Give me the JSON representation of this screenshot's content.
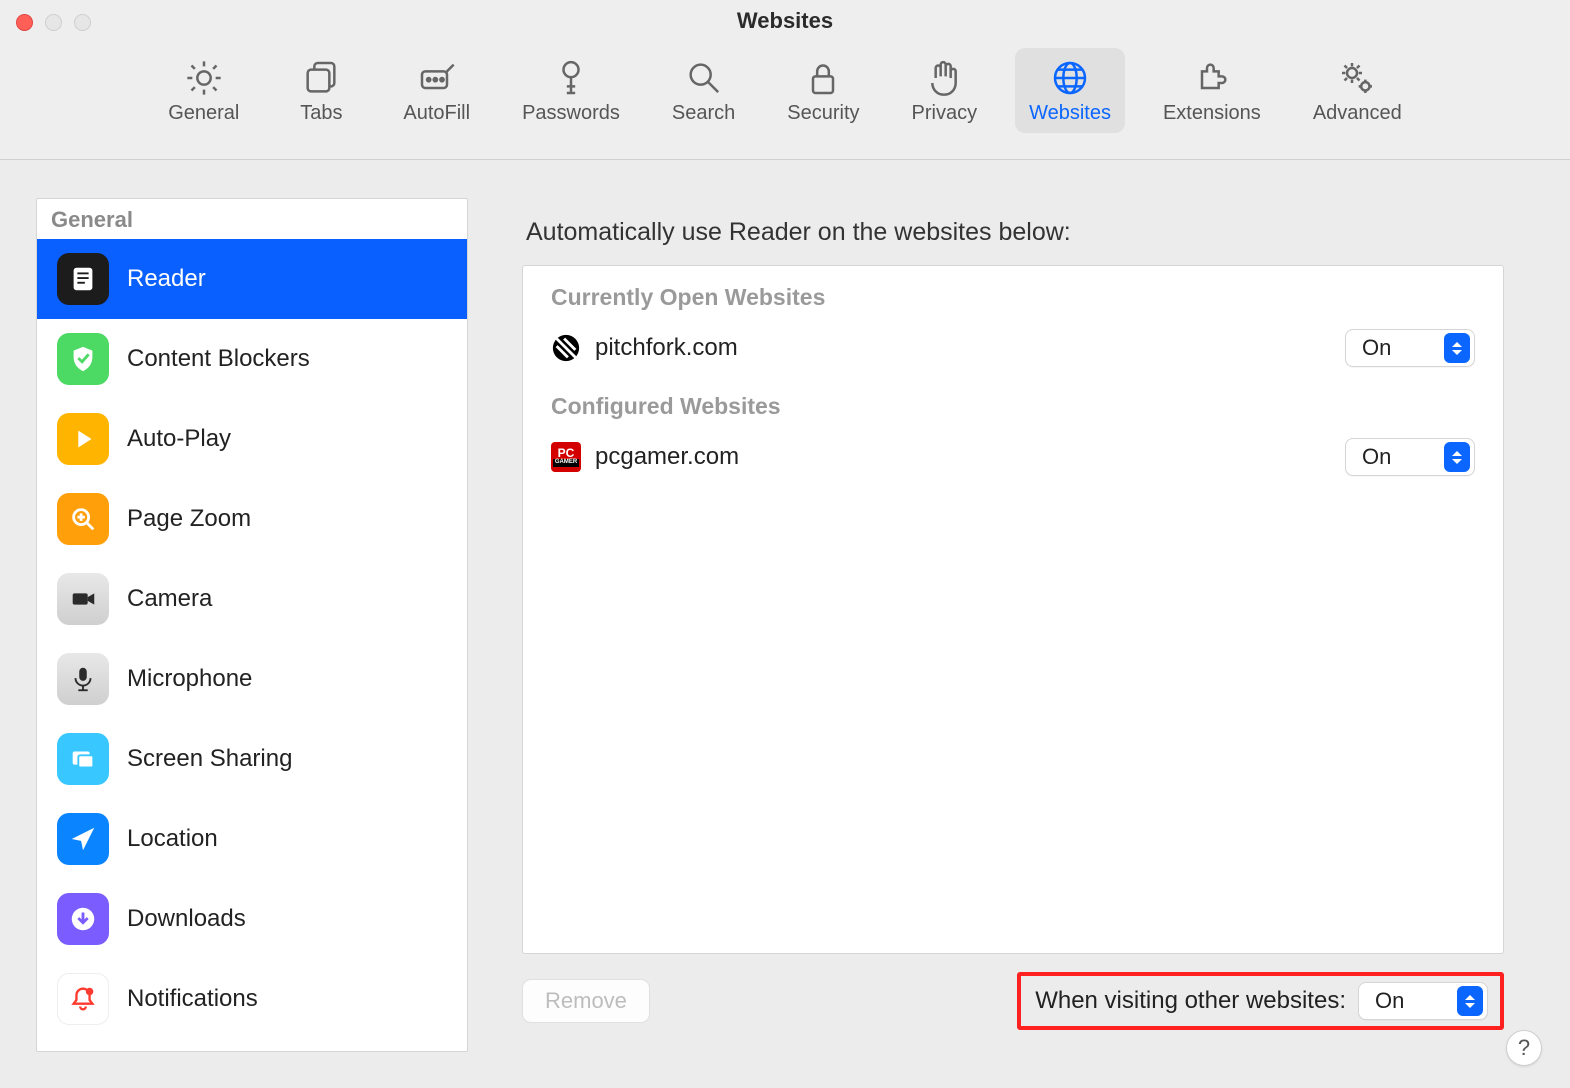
{
  "window": {
    "title": "Websites"
  },
  "toolbar": {
    "items": [
      {
        "label": "General",
        "icon": "gear"
      },
      {
        "label": "Tabs",
        "icon": "tabs"
      },
      {
        "label": "AutoFill",
        "icon": "autofill"
      },
      {
        "label": "Passwords",
        "icon": "key"
      },
      {
        "label": "Search",
        "icon": "search"
      },
      {
        "label": "Security",
        "icon": "lock"
      },
      {
        "label": "Privacy",
        "icon": "hand"
      },
      {
        "label": "Websites",
        "icon": "globe",
        "selected": true
      },
      {
        "label": "Extensions",
        "icon": "puzzle"
      },
      {
        "label": "Advanced",
        "icon": "gears"
      }
    ]
  },
  "sidebar": {
    "header": "General",
    "items": [
      {
        "label": "Reader",
        "icon": "reader",
        "bg": "#1c1c1c",
        "selected": true
      },
      {
        "label": "Content Blockers",
        "icon": "shield",
        "bg": "#4cd964"
      },
      {
        "label": "Auto-Play",
        "icon": "play",
        "bg": "#ffb400"
      },
      {
        "label": "Page Zoom",
        "icon": "zoom",
        "bg": "#ff9f0a"
      },
      {
        "label": "Camera",
        "icon": "camera",
        "bg": "#d8d8d8"
      },
      {
        "label": "Microphone",
        "icon": "mic",
        "bg": "#d8d8d8"
      },
      {
        "label": "Screen Sharing",
        "icon": "screen",
        "bg": "#38c8ff"
      },
      {
        "label": "Location",
        "icon": "location",
        "bg": "#0a84ff"
      },
      {
        "label": "Downloads",
        "icon": "download",
        "bg": "#7a5cff"
      },
      {
        "label": "Notifications",
        "icon": "bell",
        "bg": "#ffffff"
      }
    ]
  },
  "pane": {
    "heading": "Automatically use Reader on the websites below:",
    "sections": {
      "open_header": "Currently Open Websites",
      "open_rows": [
        {
          "domain": "pitchfork.com",
          "value": "On"
        }
      ],
      "configured_header": "Configured Websites",
      "configured_rows": [
        {
          "domain": "pcgamer.com",
          "value": "On"
        }
      ]
    },
    "remove_label": "Remove",
    "other_label": "When visiting other websites:",
    "other_value": "On"
  },
  "help_glyph": "?"
}
